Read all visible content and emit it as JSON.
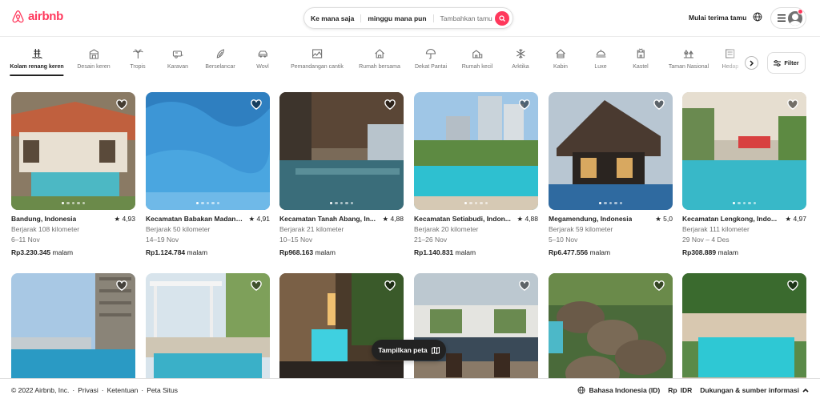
{
  "header": {
    "logo_text": "airbnb",
    "search": {
      "where": "Ke mana saja",
      "when": "minggu mana pun",
      "who": "Tambahkan tamu"
    },
    "host_link": "Mulai terima tamu"
  },
  "categories": [
    {
      "label": "Kolam renang keren",
      "icon": "pool-icon",
      "active": true
    },
    {
      "label": "Desain keren",
      "icon": "design-icon"
    },
    {
      "label": "Tropis",
      "icon": "palm-icon"
    },
    {
      "label": "Karavan",
      "icon": "caravan-icon"
    },
    {
      "label": "Berselancar",
      "icon": "surf-icon"
    },
    {
      "label": "Wovl",
      "icon": "car-icon"
    },
    {
      "label": "Pemandangan cantik",
      "icon": "view-icon"
    },
    {
      "label": "Rumah bersama",
      "icon": "house-icon"
    },
    {
      "label": "Dekat Pantai",
      "icon": "umbrella-icon"
    },
    {
      "label": "Rumah kecil",
      "icon": "small-house-icon"
    },
    {
      "label": "Arktika",
      "icon": "snowflake-icon"
    },
    {
      "label": "Kabin",
      "icon": "cabin-icon"
    },
    {
      "label": "Luxe",
      "icon": "luxe-icon"
    },
    {
      "label": "Kastel",
      "icon": "castle-icon"
    },
    {
      "label": "Taman Nasional",
      "icon": "park-icon"
    },
    {
      "label": "Hedap",
      "icon": "partial-icon"
    }
  ],
  "filter_label": "Filter",
  "listings": [
    {
      "location": "Bandung, Indonesia",
      "rating": "4,93",
      "distance": "Berjarak 108 kilometer",
      "dates": "6–11 Nov",
      "price": "Rp3.230.345",
      "per": "malam",
      "scene": "house-pool"
    },
    {
      "location": "Kecamatan Babakan Madang...",
      "rating": "4,91",
      "distance": "Berjarak 50 kilometer",
      "dates": "14–19 Nov",
      "price": "Rp1.124.784",
      "per": "malam",
      "scene": "water"
    },
    {
      "location": "Kecamatan Tanah Abang, In...",
      "rating": "4,88",
      "distance": "Berjarak 21 kilometer",
      "dates": "10–15 Nov",
      "price": "Rp968.163",
      "per": "malam",
      "scene": "rooftop"
    },
    {
      "location": "Kecamatan Setiabudi, Indon...",
      "rating": "4,88",
      "distance": "Berjarak 20 kilometer",
      "dates": "21–26 Nov",
      "price": "Rp1.140.831",
      "per": "malam",
      "scene": "city-pool"
    },
    {
      "location": "Megamendung, Indonesia",
      "rating": "5,0",
      "distance": "Berjarak 59 kilometer",
      "dates": "5–10 Nov",
      "price": "Rp6.477.556",
      "per": "malam",
      "scene": "villa"
    },
    {
      "location": "Kecamatan Lengkong, Indo...",
      "rating": "4,97",
      "distance": "Berjarak 111 kilometer",
      "dates": "29 Nov – 4 Des",
      "price": "Rp308.889",
      "per": "malam",
      "scene": "courtyard"
    },
    {
      "scene": "tower"
    },
    {
      "scene": "pergola"
    },
    {
      "scene": "night"
    },
    {
      "scene": "terrace"
    },
    {
      "scene": "huts"
    },
    {
      "scene": "garden"
    }
  ],
  "map_button": "Tampilkan peta",
  "footer": {
    "copyright": "© 2022 Airbnb, Inc.",
    "links": [
      "Privasi",
      "Ketentuan",
      "Peta Situs"
    ],
    "language": "Bahasa Indonesia (ID)",
    "currency_symbol": "Rp",
    "currency": "IDR",
    "support": "Dukungan & sumber informasi"
  },
  "colors": {
    "brand": "#ff385c",
    "text": "#222222",
    "muted": "#717171"
  }
}
